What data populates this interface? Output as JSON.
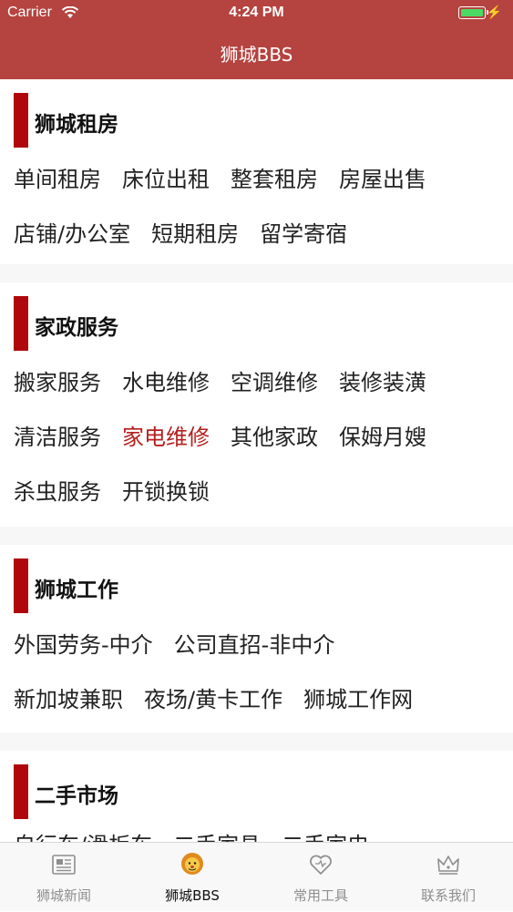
{
  "status_bar": {
    "carrier": "Carrier",
    "time": "4:24 PM"
  },
  "nav": {
    "title": "狮城BBS"
  },
  "sections": [
    {
      "title": "狮城租房",
      "rows": [
        [
          "单间租房",
          "床位出租",
          "整套租房",
          "房屋出售"
        ],
        [
          "店铺/办公室",
          "短期租房",
          "留学寄宿"
        ]
      ]
    },
    {
      "title": "家政服务",
      "rows": [
        [
          "搬家服务",
          "水电维修",
          "空调维修",
          "装修装潢"
        ],
        [
          "清洁服务",
          "家电维修",
          "其他家政",
          "保姆月嫂"
        ],
        [
          "杀虫服务",
          "开锁换锁"
        ]
      ],
      "selected": "家电维修"
    },
    {
      "title": "狮城工作",
      "rows": [
        [
          "外国劳务-中介",
          "公司直招-非中介"
        ],
        [
          "新加坡兼职",
          "夜场/黄卡工作",
          "狮城工作网"
        ]
      ]
    },
    {
      "title": "二手市场",
      "rows": [
        [
          "自行车/滑板车",
          "二手家具",
          "二手家电"
        ]
      ]
    }
  ],
  "tabs": [
    {
      "label": "狮城新闻",
      "icon": "newspaper-icon"
    },
    {
      "label": "狮城BBS",
      "icon": "lion-icon",
      "active": true
    },
    {
      "label": "常用工具",
      "icon": "heart-icon"
    },
    {
      "label": "联系我们",
      "icon": "crown-icon"
    }
  ],
  "colors": {
    "brand": "#b5433f",
    "accent_bar": "#b0070c",
    "selected_text": "#b5201e"
  }
}
